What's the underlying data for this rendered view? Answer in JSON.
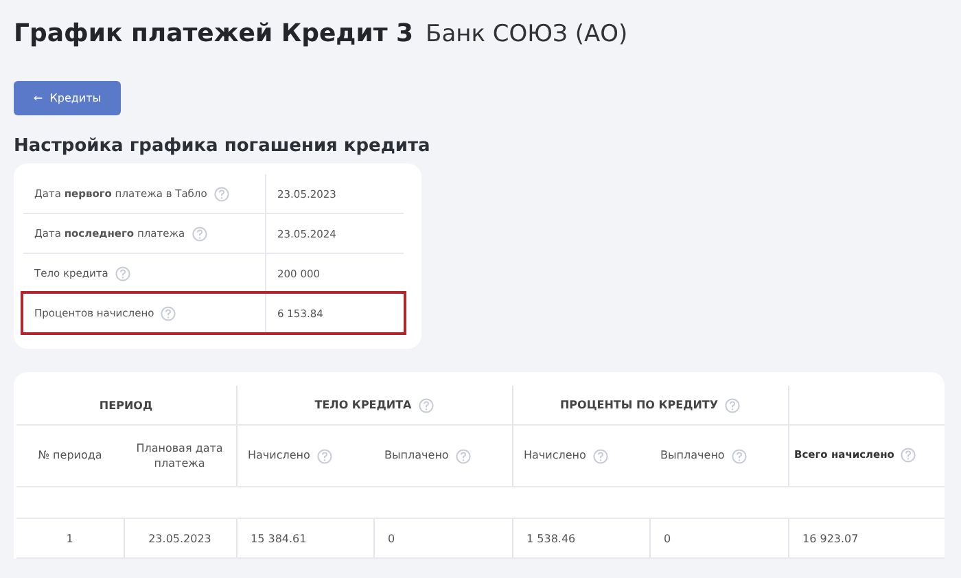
{
  "page": {
    "title": "График платежей Кредит 3",
    "subtitle": "Банк СОЮЗ (АО)"
  },
  "back_button": {
    "arrow": "←",
    "label": "Кредиты"
  },
  "settings": {
    "title": "Настройка графика погашения кредита",
    "rows": [
      {
        "label": "Дата **первого** платежа в Табло",
        "help": true,
        "value": "23.05.2023",
        "highlighted": false
      },
      {
        "label": "Дата **последнего** платежа",
        "help": true,
        "value": "23.05.2024",
        "highlighted": false
      },
      {
        "label": "Тело кредита",
        "help": true,
        "value": "200 000",
        "highlighted": false
      },
      {
        "label": "Процентов начислено",
        "help": true,
        "value": "6 153.84",
        "highlighted": true
      }
    ]
  },
  "schedule": {
    "groups": [
      {
        "label": "ПЕРИОД",
        "help": false
      },
      {
        "label": "ТЕЛО КРЕДИТА",
        "help": true
      },
      {
        "label": "ПРОЦЕНТЫ ПО КРЕДИТУ",
        "help": true
      },
      {
        "help": false
      }
    ],
    "columns": [
      {
        "label": "№ периода",
        "help": false
      },
      {
        "label": "Плановая дата платежа",
        "help": false
      },
      {
        "label": "Начислено",
        "help": true
      },
      {
        "label": "Выплачено",
        "help": true
      },
      {
        "label": "Начислено",
        "help": true
      },
      {
        "label": "Выплачено",
        "help": true
      },
      {
        "label": "Всего начислено",
        "help": true
      }
    ],
    "rows": [
      [
        "1",
        "23.05.2023",
        "15 384.61",
        "0",
        "1 538.46",
        "0",
        "16 923.07"
      ]
    ]
  }
}
